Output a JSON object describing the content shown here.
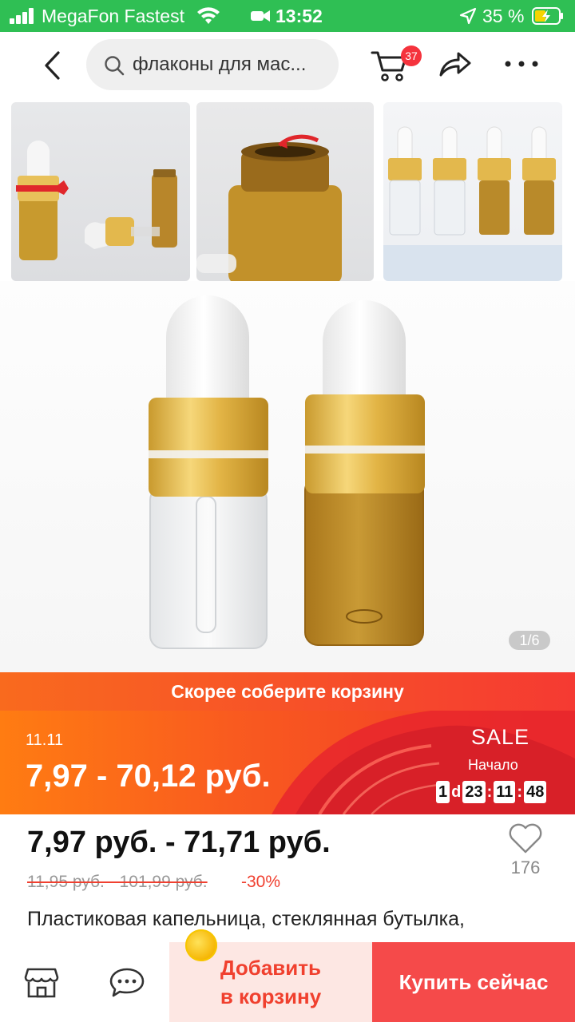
{
  "status_bar": {
    "carrier": "MegaFon Fastest",
    "time": "13:52",
    "battery_percent": "35 %"
  },
  "header": {
    "search_text": "флаконы для мас...",
    "cart_count": "37"
  },
  "gallery": {
    "image_counter": "1/6"
  },
  "promo": {
    "banner_text": "Скорее соберите корзину",
    "event_date": "11.11",
    "sale_price": "7,97 - 70,12 руб.",
    "sale_label": "SALE",
    "start_label": "Начало",
    "countdown": {
      "days": "1",
      "days_unit": "d",
      "hours": "23",
      "minutes": "11",
      "seconds": "48"
    }
  },
  "product": {
    "price": "7,97 руб. - 71,71 руб.",
    "old_price": "11,95 руб. - 101,99 руб.",
    "discount": "-30%",
    "favorites_count": "176",
    "title": "Пластиковая капельница, стеклянная бутылка,"
  },
  "bottom_bar": {
    "add_to_cart_line1": "Добавить",
    "add_to_cart_line2": "в корзину",
    "buy_now": "Купить сейчас"
  },
  "colors": {
    "status_bar": "#2fbf54",
    "accent_red": "#f54a4a",
    "promo_orange": "#ff7c12"
  }
}
